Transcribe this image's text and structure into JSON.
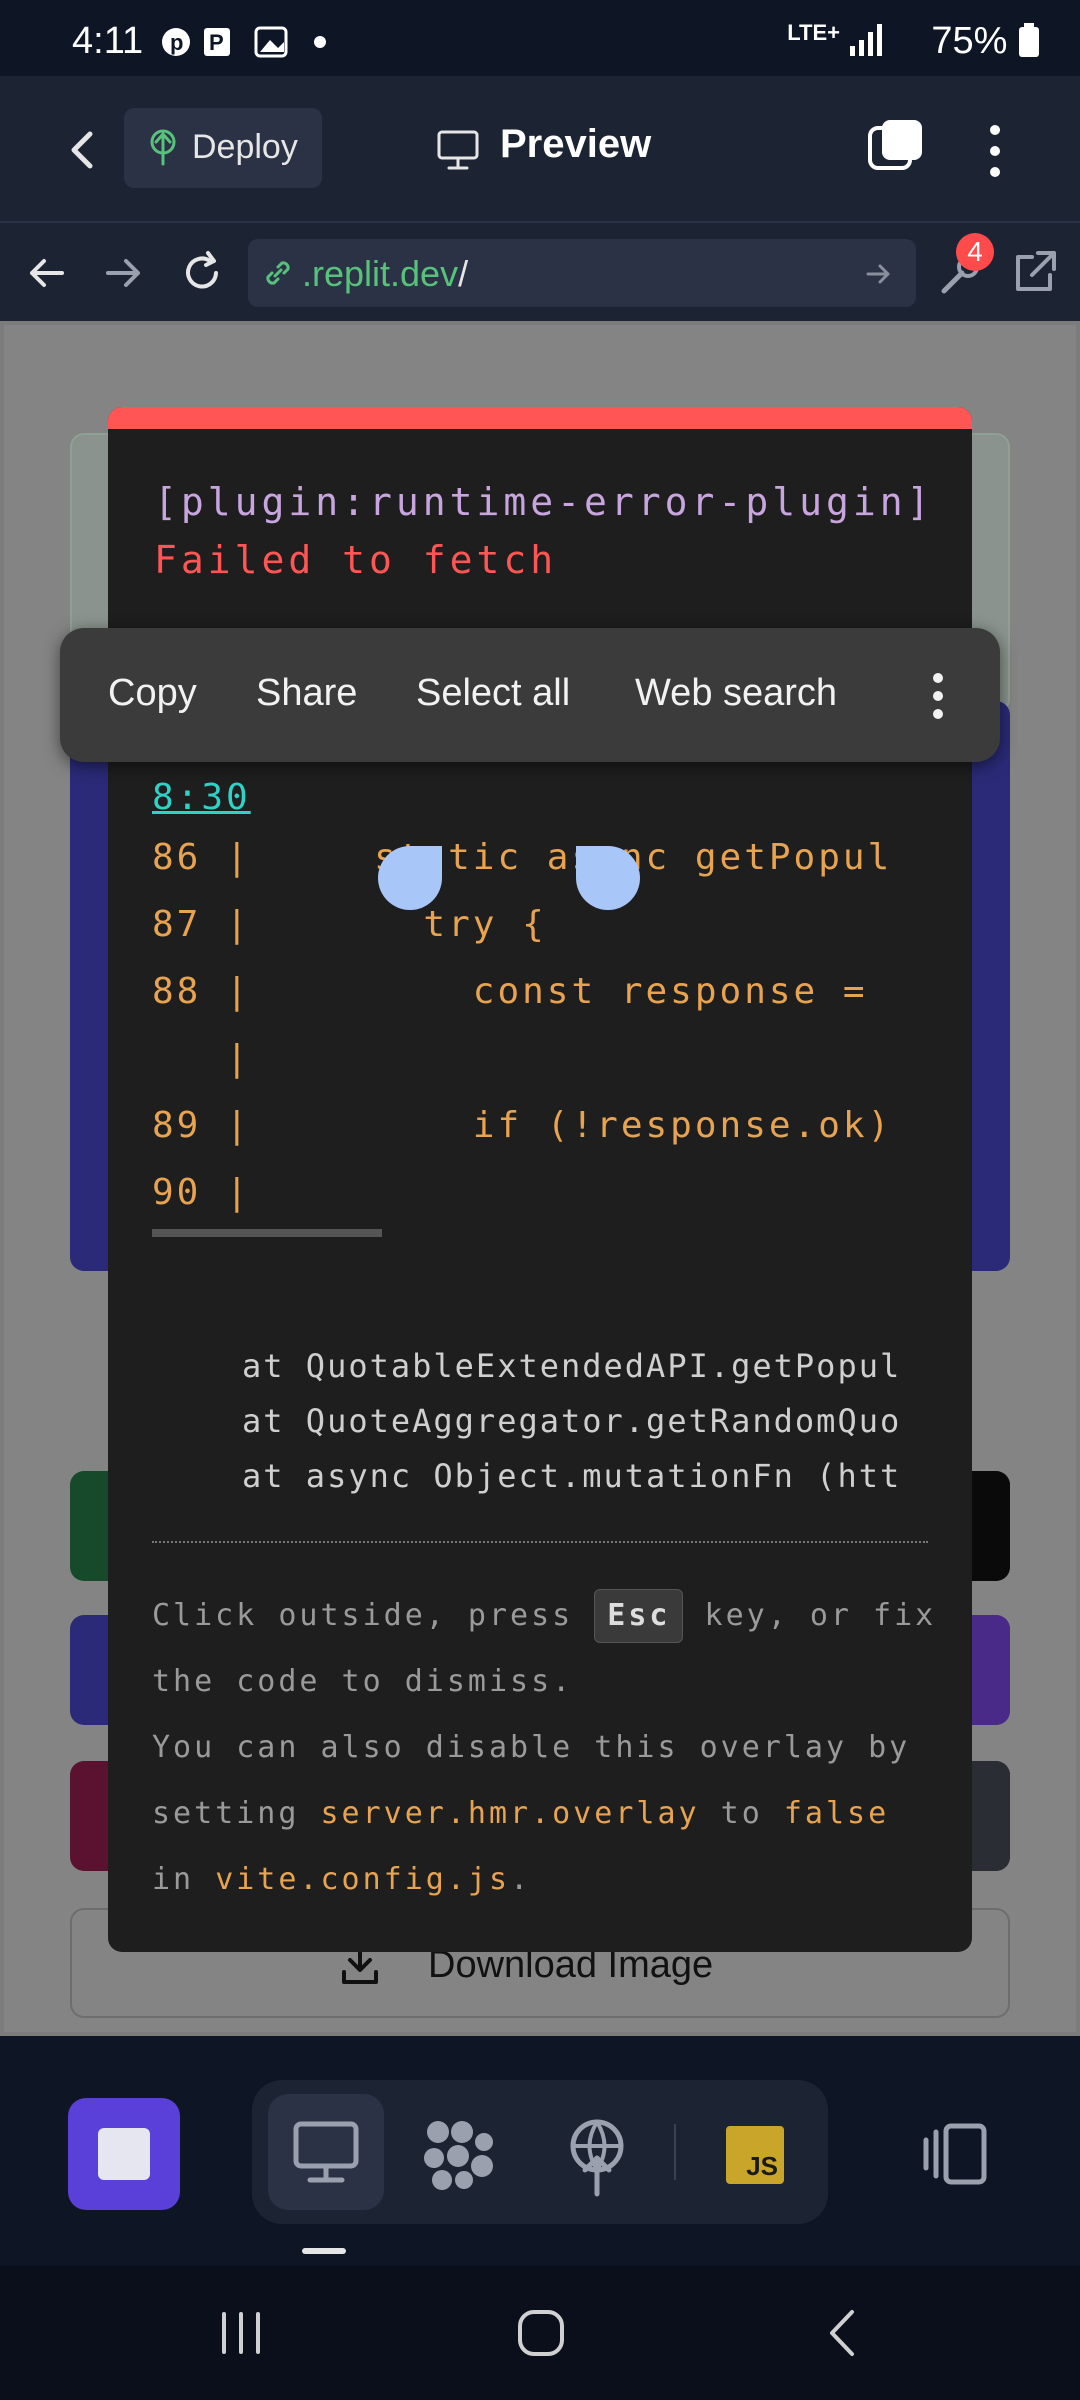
{
  "status_bar": {
    "time": "4:11",
    "network": "LTE+",
    "battery": "75%"
  },
  "app_bar": {
    "deploy_label": "Deploy",
    "preview_label": "Preview"
  },
  "url_bar": {
    "url": ".replit.dev",
    "url_suffix": "/",
    "badge_count": "4"
  },
  "overlay": {
    "plugin_tag": "[plugin:runtime-error-plugin]",
    "error_message": "Failed to fetch",
    "file_ref": "8:30",
    "code_lines": [
      {
        "num": "86 |",
        "text": "    static async getPopul"
      },
      {
        "num": "87 |",
        "text": "      try {"
      },
      {
        "num": "88 |",
        "text": "        const response ="
      },
      {
        "num": "   |",
        "text": ""
      },
      {
        "num": "89 |",
        "text": "        if (!response.ok)"
      },
      {
        "num": "90 |",
        "text": ""
      }
    ],
    "stack": [
      "at QuotableExtendedAPI.getPopul",
      "at QuoteAggregator.getRandomQuo",
      "at async Object.mutationFn (htt"
    ],
    "tip_1a": "Click outside, press",
    "tip_key": "Esc",
    "tip_1b": "key, or fix the code to dismiss.",
    "tip_2a": "You can also disable this overlay by setting",
    "tip_2_code1": "server.hmr.overlay",
    "tip_2b": "to",
    "tip_2_code2": "false",
    "tip_2c": "in",
    "tip_2_code3": "vite.config.js",
    "tip_2d": "."
  },
  "context_menu": {
    "items": [
      "Copy",
      "Share",
      "Select all",
      "Web search"
    ]
  },
  "page": {
    "download_label": "Download Image"
  },
  "toolbar": {
    "js_label": "JS"
  },
  "colors": {
    "accent": "#5a3fd9",
    "error_bar": "#ff5555",
    "url_green": "#58c27d"
  }
}
